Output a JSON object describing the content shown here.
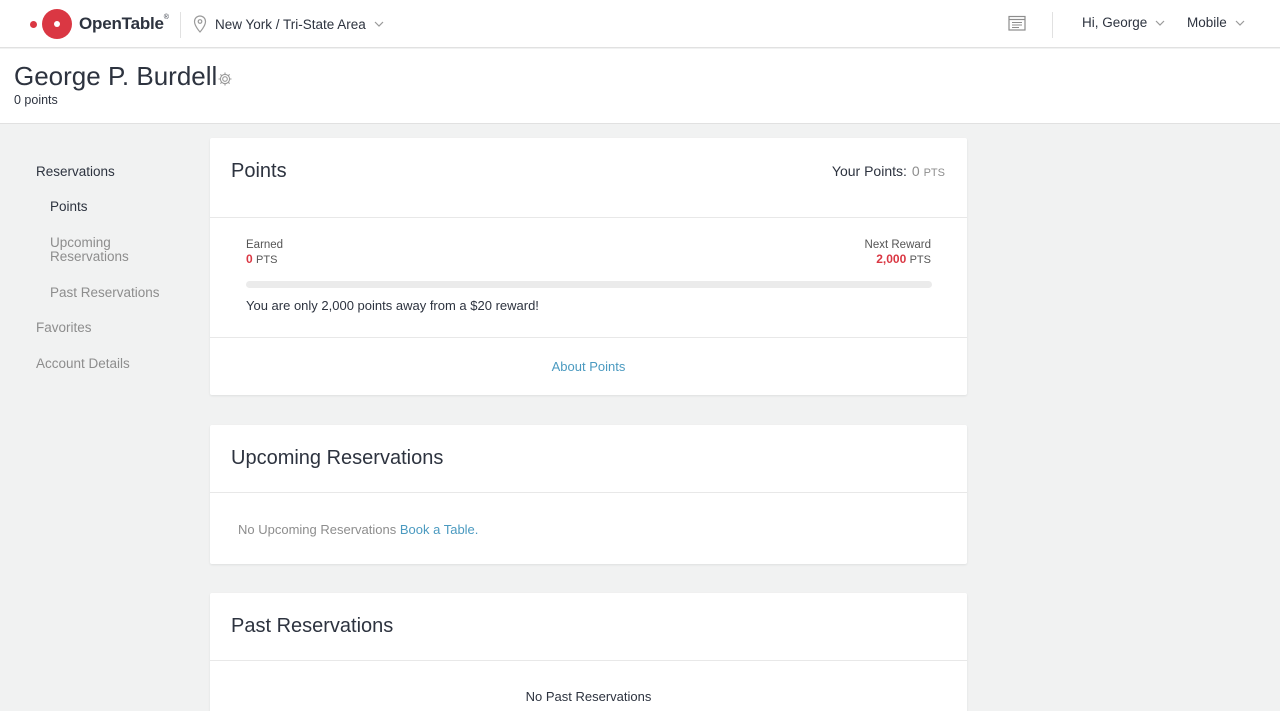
{
  "nav": {
    "brand": "OpenTable",
    "brand_mark": "®",
    "location": "New York / Tri-State Area",
    "user_greeting": "Hi, George",
    "mobile_label": "Mobile"
  },
  "profile": {
    "name": "George P. Burdell",
    "points_label": "0 points"
  },
  "sidebar": {
    "items": [
      {
        "label": "Reservations"
      },
      {
        "label": "Points"
      },
      {
        "label": "Upcoming Reservations"
      },
      {
        "label": "Past Reservations"
      },
      {
        "label": "Favorites"
      },
      {
        "label": "Account Details"
      }
    ]
  },
  "points_card": {
    "title": "Points",
    "your_points_label": "Your Points:",
    "your_points_value": "0",
    "pts_unit": "PTS",
    "earned_label": "Earned",
    "earned_value": "0",
    "next_reward_label": "Next Reward",
    "next_reward_value": "2,000",
    "progress_fraction": 0,
    "message": "You are only 2,000 points away from a $20 reward!",
    "about_link": "About Points"
  },
  "upcoming_card": {
    "title": "Upcoming Reservations",
    "empty_text": "No Upcoming Reservations",
    "book_link": "Book a Table."
  },
  "past_card": {
    "title": "Past Reservations",
    "empty_text": "No Past Reservations"
  },
  "colors": {
    "brand_red": "#da3743",
    "link_blue": "#4b9ac0",
    "background": "#f1f2f2"
  }
}
